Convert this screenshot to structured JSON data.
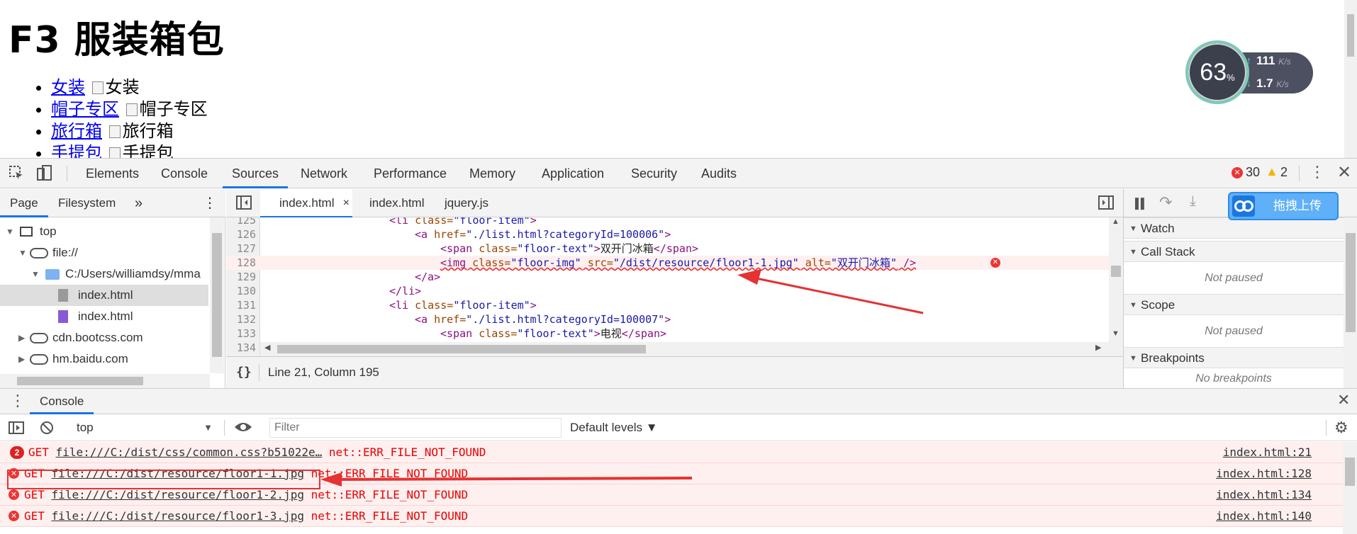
{
  "page": {
    "heading": "F3 服装箱包",
    "items": [
      {
        "link": "女装",
        "alt": "女装"
      },
      {
        "link": "帽子专区",
        "alt": "帽子专区"
      },
      {
        "link": "旅行箱",
        "alt": "旅行箱"
      },
      {
        "link": "手提包",
        "alt": "手提包"
      }
    ]
  },
  "net_widget": {
    "percent": "63",
    "percent_unit": "%",
    "up_value": "111",
    "down_value": "1.7",
    "unit": "K/s"
  },
  "devtools": {
    "tabs": [
      "Elements",
      "Console",
      "Sources",
      "Network",
      "Performance",
      "Memory",
      "Application",
      "Security",
      "Audits"
    ],
    "active_tab": "Sources",
    "error_count": "30",
    "warning_count": "2"
  },
  "navigator": {
    "tabs": [
      "Page",
      "Filesystem"
    ],
    "active_tab": "Page",
    "more": "»",
    "tree": [
      {
        "label": "top",
        "icon": "frame-icon",
        "depth": 0,
        "expanded": true
      },
      {
        "label": "file://",
        "icon": "cloud-icon",
        "depth": 1,
        "expanded": true
      },
      {
        "label": "C:/Users/williamdsy/mma",
        "icon": "folder-icon",
        "depth": 2,
        "expanded": true
      },
      {
        "label": "index.html",
        "icon": "file-icon",
        "depth": 3,
        "selected": true
      },
      {
        "label": "index.html",
        "icon": "file-icon-purple",
        "depth": 3
      },
      {
        "label": "cdn.bootcss.com",
        "icon": "cloud-icon",
        "depth": 1,
        "expanded": false
      },
      {
        "label": "hm.baidu.com",
        "icon": "cloud-icon",
        "depth": 1,
        "expanded": false
      }
    ]
  },
  "editor": {
    "tabs": [
      {
        "label": "index.html",
        "closable": true,
        "active": true
      },
      {
        "label": "index.html",
        "closable": false,
        "active": false
      },
      {
        "label": "jquery.js",
        "closable": false,
        "active": false
      }
    ],
    "close_glyph": "×",
    "lines": [
      {
        "n": "125",
        "indent": 20,
        "html": "<span class=\"tag\">&lt;li</span> <span class=\"attr\">class=</span><span class=\"val\">\"floor-item\"</span><span class=\"tag\">&gt;</span>"
      },
      {
        "n": "126",
        "indent": 24,
        "html": "<span class=\"tag\">&lt;a</span> <span class=\"attr\">href=</span><span class=\"val\">\"./list.html?categoryId=100006\"</span><span class=\"tag\">&gt;</span>"
      },
      {
        "n": "127",
        "indent": 28,
        "html": "<span class=\"tag\">&lt;span</span> <span class=\"attr\">class=</span><span class=\"val\">\"floor-text\"</span><span class=\"tag\">&gt;</span><span class=\"txt\">双开门冰箱</span><span class=\"tag\">&lt;/span&gt;</span>"
      },
      {
        "n": "128",
        "indent": 28,
        "err": true,
        "html": "<span class=\"squig\"><span class=\"tag\">&lt;img</span> <span class=\"attr\">class=</span><span class=\"val\">\"floor-img\"</span> <span class=\"attr\">src=</span><span class=\"val\">\"/dist/resource/floor1-1.jpg\"</span> <span class=\"attr\">alt=</span><span class=\"val\">\"双开门冰箱\"</span> <span class=\"tag\">/&gt;</span></span>"
      },
      {
        "n": "129",
        "indent": 24,
        "html": "<span class=\"tag\">&lt;/a&gt;</span>"
      },
      {
        "n": "130",
        "indent": 20,
        "html": "<span class=\"tag\">&lt;/li&gt;</span>"
      },
      {
        "n": "131",
        "indent": 20,
        "html": "<span class=\"tag\">&lt;li</span> <span class=\"attr\">class=</span><span class=\"val\">\"floor-item\"</span><span class=\"tag\">&gt;</span>"
      },
      {
        "n": "132",
        "indent": 24,
        "html": "<span class=\"tag\">&lt;a</span> <span class=\"attr\">href=</span><span class=\"val\">\"./list.html?categoryId=100007\"</span><span class=\"tag\">&gt;</span>"
      },
      {
        "n": "133",
        "indent": 28,
        "html": "<span class=\"tag\">&lt;span</span> <span class=\"attr\">class=</span><span class=\"val\">\"floor-text\"</span><span class=\"tag\">&gt;</span><span class=\"txt\">电视</span><span class=\"tag\">&lt;/span&gt;</span>"
      },
      {
        "n": "134",
        "indent": 0,
        "html": ""
      }
    ],
    "status": "Line 21, Column 195",
    "pretty_print": "{}"
  },
  "debugger": {
    "sections": [
      {
        "title": "Watch",
        "body": ""
      },
      {
        "title": "Call Stack",
        "body": "Not paused"
      },
      {
        "title": "Scope",
        "body": "Not paused"
      },
      {
        "title": "Breakpoints",
        "body": "No breakpoints"
      }
    ],
    "upload_button": "拖拽上传"
  },
  "drawer": {
    "tab": "Console",
    "context": "top",
    "filter_placeholder": "Filter",
    "levels": "Default levels ▼",
    "messages": [
      {
        "badge": "2",
        "method": "GET",
        "url": "file:///C:/dist/css/common.css?b51022e…",
        "error": "net::ERR_FILE_NOT_FOUND",
        "source": "index.html:21"
      },
      {
        "method": "GET",
        "url": "file:///C:/dist/resource/floor1-1.jpg",
        "error": "net::ERR_FILE_NOT_FOUND",
        "source": "index.html:128"
      },
      {
        "method": "GET",
        "url": "file:///C:/dist/resource/floor1-2.jpg",
        "error": "net::ERR_FILE_NOT_FOUND",
        "source": "index.html:134"
      },
      {
        "method": "GET",
        "url": "file:///C:/dist/resource/floor1-3.jpg",
        "error": "net::ERR_FILE_NOT_FOUND",
        "source": "index.html:140"
      }
    ]
  },
  "colors": {
    "accent": "#1a73e8",
    "error": "#e53232",
    "error_bg": "#fff0f0",
    "annotation": "#e53232"
  }
}
